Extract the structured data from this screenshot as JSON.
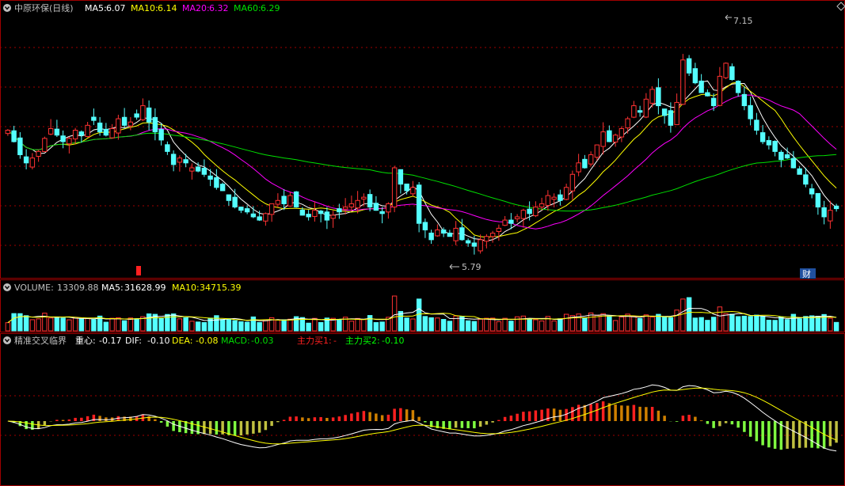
{
  "colors": {
    "up": "#ff3232",
    "down": "#54ffff",
    "ma5": "#ffffff",
    "ma10": "#ffff00",
    "ma20": "#ff00ff",
    "ma60": "#00e000",
    "grid": "#a00000",
    "label": "#c0c0c0",
    "macd_pos": "#ff2020",
    "macd_pos_weak": "#d08000",
    "macd_neg": "#80ff40",
    "macd_neg_weak": "#c0c040",
    "dif": "#ffffff",
    "dea": "#ffff00",
    "mainbuy2": "#00ff00"
  },
  "main_panel": {
    "header": {
      "title": "中原环保(日线)",
      "ma5_label": "MA5:",
      "ma5_value": "6.07",
      "ma10_label": "MA10:",
      "ma10_value": "6.14",
      "ma20_label": "MA20:",
      "ma20_value": "6.32",
      "ma60_label": "MA60:",
      "ma60_value": "6.29"
    },
    "annotations": {
      "high": "7.15",
      "low": "5.79",
      "finance_badge": "财"
    }
  },
  "volume_panel": {
    "header": {
      "label": "VOLUME:",
      "value": "13309.88",
      "ma5_label": "MA5:",
      "ma5_value": "31628.99",
      "ma10_label": "MA10:",
      "ma10_value": "34715.39"
    }
  },
  "indicator_panel": {
    "header": {
      "name": "精准交叉临界",
      "zx_label": "重心:",
      "zx_value": "-0.17",
      "dif_label": "DIF:",
      "dif_value": "-0.10",
      "dea_label": "DEA:",
      "dea_value": "-0.08",
      "macd_label": "MACD:",
      "macd_value": "-0.03",
      "buy1_label": "主力买1:",
      "buy1_value": "-",
      "buy2_label": "主力买2:",
      "buy2_value": "-0.10"
    }
  },
  "chart_data": [
    {
      "type": "candlestick",
      "title": "中原环保(日线)",
      "price_range": [
        5.7,
        7.25
      ],
      "reference_points": [
        {
          "label": "7.15",
          "kind": "high"
        },
        {
          "label": "5.79",
          "kind": "low"
        }
      ],
      "close": [
        6.55,
        6.48,
        6.4,
        6.35,
        6.38,
        6.42,
        6.5,
        6.56,
        6.52,
        6.48,
        6.5,
        6.55,
        6.52,
        6.58,
        6.61,
        6.54,
        6.52,
        6.56,
        6.62,
        6.58,
        6.6,
        6.63,
        6.7,
        6.6,
        6.54,
        6.49,
        6.42,
        6.34,
        6.38,
        6.35,
        6.32,
        6.3,
        6.28,
        6.25,
        6.2,
        6.18,
        6.12,
        6.08,
        6.06,
        6.05,
        6.02,
        6.0,
        6.04,
        6.1,
        6.12,
        6.1,
        6.15,
        6.08,
        6.03,
        6.02,
        6.06,
        6.04,
        6.0,
        6.03,
        6.05,
        6.08,
        6.1,
        6.12,
        6.14,
        6.08,
        6.06,
        6.04,
        6.1,
        6.32,
        6.22,
        6.18,
        6.2,
        5.98,
        5.94,
        5.88,
        5.94,
        5.92,
        5.9,
        5.95,
        5.88,
        5.86,
        5.84,
        5.88,
        5.9,
        5.92,
        5.95,
        6.0,
        5.98,
        6.02,
        6.06,
        6.04,
        6.08,
        6.1,
        6.15,
        6.14,
        6.12,
        6.2,
        6.28,
        6.35,
        6.32,
        6.4,
        6.46,
        6.54,
        6.48,
        6.52,
        6.56,
        6.62,
        6.7,
        6.66,
        6.74,
        6.8,
        6.7,
        6.64,
        6.58,
        6.72,
        6.98,
        6.9,
        6.84,
        6.78,
        6.76,
        6.7,
        6.88,
        6.96,
        6.86,
        6.78,
        6.7,
        6.62,
        6.55,
        6.48,
        6.46,
        6.42,
        6.37,
        6.38,
        6.32,
        6.28,
        6.22,
        6.16,
        6.08,
        6.02,
        6.06,
        6.07
      ],
      "volume_note": "Daily volume bars with MA5/MA10 overlays"
    },
    {
      "type": "bar+line",
      "title": "VOLUME",
      "series": [
        {
          "name": "VOLUME"
        },
        {
          "name": "MA5"
        },
        {
          "name": "MA10"
        }
      ]
    },
    {
      "type": "bar+line",
      "title": "精准交叉临界",
      "series": [
        {
          "name": "DIF"
        },
        {
          "name": "DEA"
        },
        {
          "name": "MACD"
        }
      ]
    }
  ]
}
